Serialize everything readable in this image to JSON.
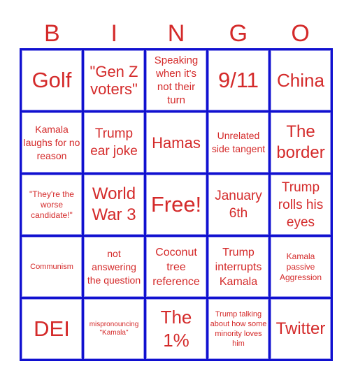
{
  "card": {
    "header": [
      "B",
      "I",
      "N",
      "G",
      "O"
    ],
    "colors": {
      "text": "#d42a2a",
      "grid": "#1010d0",
      "background": "#ffffff"
    },
    "rows": [
      [
        "Golf",
        "\"Gen Z voters\"",
        "Speaking when it's not their turn",
        "9/11",
        "China"
      ],
      [
        "Kamala laughs for no reason",
        "Trump ear joke",
        "Hamas",
        "Unrelated side tangent",
        "The border"
      ],
      [
        "\"They're the worse candidate!\"",
        "World War 3",
        "Free!",
        "January 6th",
        "Trump rolls his eyes"
      ],
      [
        "Communism",
        "not answering the question",
        "Coconut tree reference",
        "Trump interrupts Kamala",
        "Kamala passive Aggression"
      ],
      [
        "DEI",
        "mispronouncing \"Kamala\"",
        "The 1%",
        "Trump talking about how some minority loves him",
        "Twitter"
      ]
    ]
  }
}
